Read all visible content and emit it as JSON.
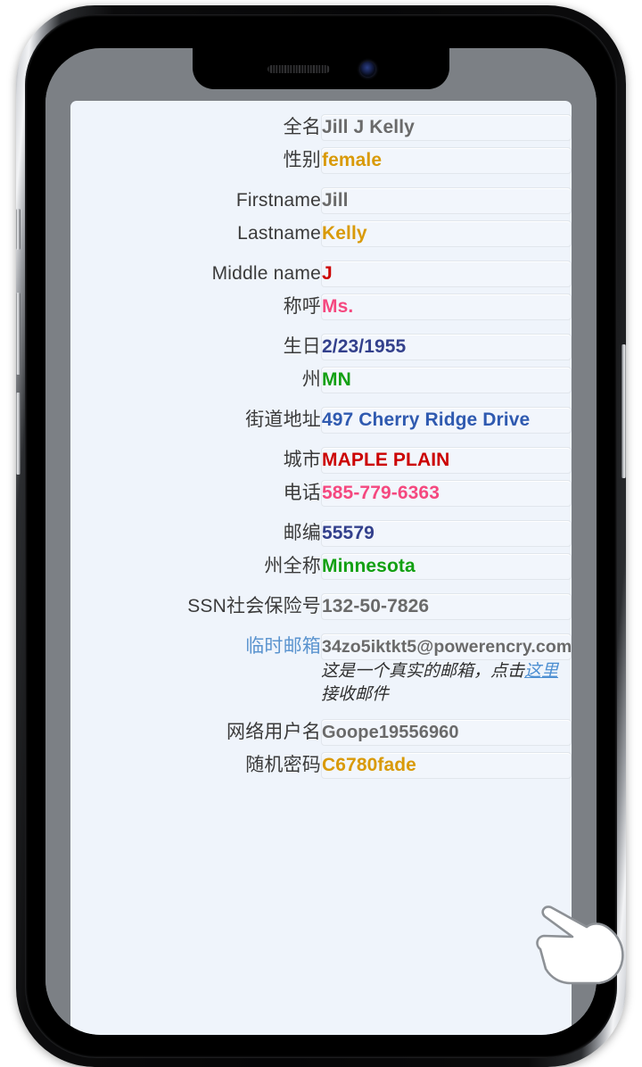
{
  "device": {
    "notch": {
      "speaker": "speaker-grille",
      "camera": "front-camera"
    },
    "buttons": [
      {
        "name": "silent-switch",
        "side": "left"
      },
      {
        "name": "volume-up-button",
        "side": "left"
      },
      {
        "name": "volume-down-button",
        "side": "left"
      },
      {
        "name": "power-button",
        "side": "right"
      }
    ]
  },
  "colors": {
    "label": "#3b3b3b",
    "link": "#5b94cf",
    "gray_value": "#6a6a6a",
    "orange": "#d99a08",
    "red": "#cc0000",
    "pink": "#f5487f",
    "navy": "#33408c",
    "green": "#12a012",
    "blue": "#2f5ab0",
    "card_bg": "#eff4fb",
    "screen_bg": "#7c8085",
    "cell_border": "#e1e6ec"
  },
  "form": {
    "rows": [
      {
        "label": "全名",
        "value": "Jill J Kelly",
        "color": "#6a6a6a",
        "gap_before": "none",
        "label_link": false
      },
      {
        "label": "性别",
        "value": "female",
        "color": "#d99a08",
        "gap_before": "small",
        "label_link": false
      },
      {
        "label": "Firstname",
        "value": "Jill",
        "color": "#6a6a6a",
        "gap_before": "large",
        "label_link": false
      },
      {
        "label": "Lastname",
        "value": "Kelly",
        "color": "#d99a08",
        "gap_before": "small",
        "label_link": false
      },
      {
        "label": "Middle name",
        "value": "J",
        "color": "#cc0000",
        "gap_before": "large",
        "label_link": false
      },
      {
        "label": "称呼",
        "value": "Ms.",
        "color": "#f5487f",
        "gap_before": "small",
        "label_link": false
      },
      {
        "label": "生日",
        "value": "2/23/1955",
        "color": "#33408c",
        "gap_before": "large",
        "label_link": false
      },
      {
        "label": "州",
        "value": "MN",
        "color": "#12a012",
        "gap_before": "small",
        "label_link": false
      },
      {
        "label": "街道地址",
        "value": "497 Cherry Ridge Drive",
        "color": "#2f5ab0",
        "gap_before": "large",
        "label_link": false
      },
      {
        "label": "城市",
        "value": "MAPLE PLAIN",
        "color": "#cc0000",
        "gap_before": "large",
        "label_link": false
      },
      {
        "label": "电话",
        "value": "585-779-6363",
        "color": "#f5487f",
        "gap_before": "small",
        "label_link": false
      },
      {
        "label": "邮编",
        "value": "55579",
        "color": "#33408c",
        "gap_before": "large",
        "label_link": false
      },
      {
        "label": "州全称",
        "value": "Minnesota",
        "color": "#12a012",
        "gap_before": "small",
        "label_link": false
      },
      {
        "label": "SSN社会保险号",
        "value": "132-50-7826",
        "color": "#6a6a6a",
        "gap_before": "large",
        "label_link": false
      },
      {
        "label": "临时邮箱",
        "value": "34zo5iktkt5@powerencry.com",
        "color": "#6a6a6a",
        "gap_before": "large",
        "label_link": true
      },
      {
        "label": "网络用户名",
        "value": "Goope19556960",
        "color": "#6a6a6a",
        "gap_before": "large",
        "label_link": false
      },
      {
        "label": "随机密码",
        "value": "C6780fade",
        "color": "#d99a08",
        "gap_before": "small",
        "label_link": false
      }
    ],
    "email_note": {
      "prefix": "这是一个真实的邮箱，点击",
      "link": "这里",
      "suffix": "接收邮件"
    }
  },
  "cursor": {
    "icon": "pointing-hand-cursor"
  }
}
